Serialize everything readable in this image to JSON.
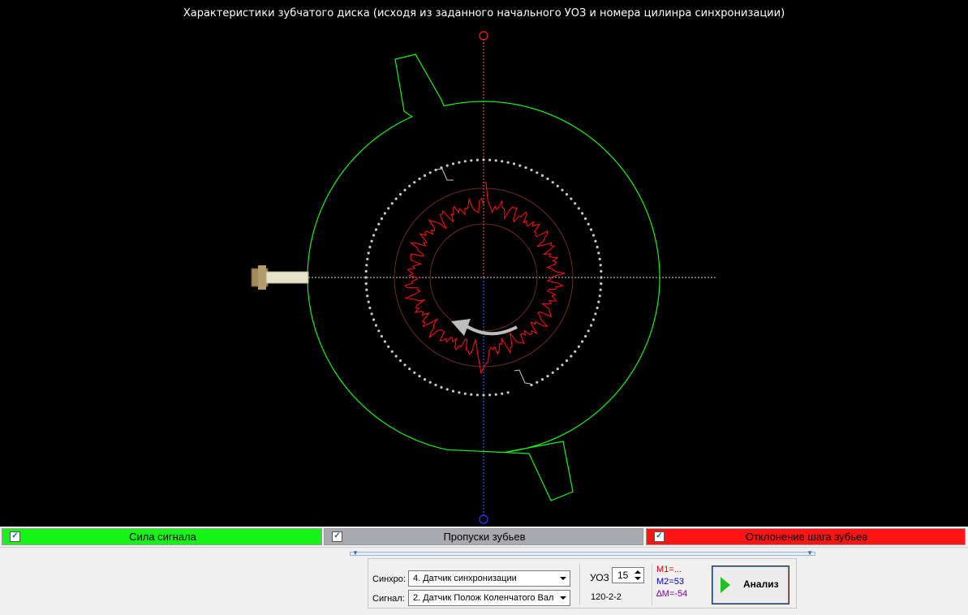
{
  "title": "Характеристики зубчатого диска (исходя из заданного начального УОЗ и номера цилинра синхронизации)",
  "legend": [
    {
      "label": "Сила сигнала",
      "checked": true,
      "color": "#16f316"
    },
    {
      "label": "Пропуски зубьев",
      "checked": true,
      "color": "#a9a9b0"
    },
    {
      "label": "Отклонение шага зубьев",
      "checked": true,
      "color": "#ff1313"
    }
  ],
  "controls": {
    "sync_label": "Синхро:",
    "sync_value": "4.  Датчик синхронизации",
    "signal_label": "Сигнал:",
    "signal_value": "2.  Датчик Полож Коленчатого Вал",
    "uoz_label": "УОЗ",
    "uoz_value": "15",
    "pattern": "120-2-2",
    "m1": "M1=...",
    "m2": "M2=53",
    "dm": "∆M=-54",
    "analyze_label": "Анализ"
  },
  "colors": {
    "background": "#000000",
    "signal_strength": "#16f316",
    "tooth_dots": "#c8c8c8",
    "pitch_deviation": "#ff1313",
    "m1": "#d10000",
    "m2": "#0000c0",
    "dm": "#8000a0"
  }
}
